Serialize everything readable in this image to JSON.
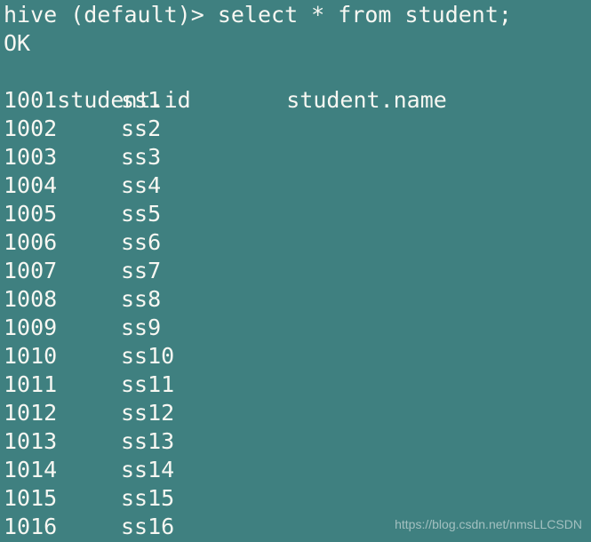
{
  "terminal": {
    "background_color": "#3f8080",
    "text_color": "#f7f7f2",
    "prompt_line": "hive (default)> select * from student;",
    "status_line": "OK",
    "columns": {
      "id_header": "student.id",
      "name_header": "student.name"
    },
    "rows": [
      {
        "id": "1001",
        "name": "ss1"
      },
      {
        "id": "1002",
        "name": "ss2"
      },
      {
        "id": "1003",
        "name": "ss3"
      },
      {
        "id": "1004",
        "name": "ss4"
      },
      {
        "id": "1005",
        "name": "ss5"
      },
      {
        "id": "1006",
        "name": "ss6"
      },
      {
        "id": "1007",
        "name": "ss7"
      },
      {
        "id": "1008",
        "name": "ss8"
      },
      {
        "id": "1009",
        "name": "ss9"
      },
      {
        "id": "1010",
        "name": "ss10"
      },
      {
        "id": "1011",
        "name": "ss11"
      },
      {
        "id": "1012",
        "name": "ss12"
      },
      {
        "id": "1013",
        "name": "ss13"
      },
      {
        "id": "1014",
        "name": "ss14"
      },
      {
        "id": "1015",
        "name": "ss15"
      },
      {
        "id": "1016",
        "name": "ss16"
      }
    ]
  },
  "watermark": {
    "text": "https://blog.csdn.net/nmsLLCSDN",
    "color": "#c9d9d9"
  }
}
